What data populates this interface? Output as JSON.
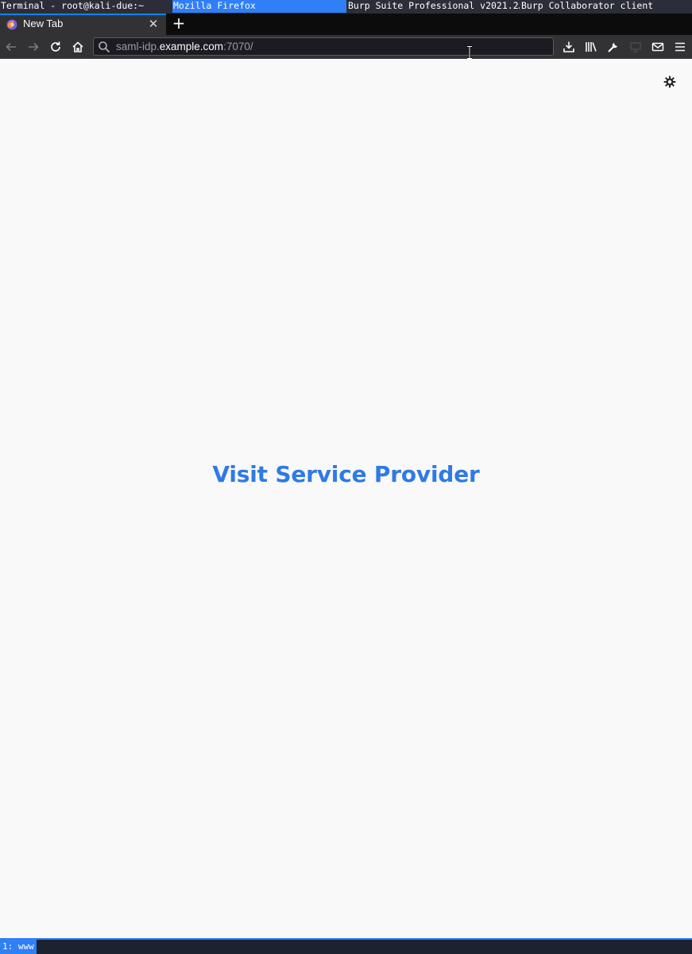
{
  "taskbar": {
    "tasks": [
      {
        "label": "Terminal - root@kali-due:~",
        "active": false
      },
      {
        "label": "Mozilla Firefox",
        "active": true
      },
      {
        "label": "Burp Suite Professional v2021.2…",
        "active": false
      },
      {
        "label": "Burp Collaborator client",
        "active": false
      }
    ]
  },
  "browser": {
    "tab": {
      "title": "New Tab",
      "close_glyph": "✕"
    },
    "new_tab_glyph": "+",
    "url": {
      "prefix": "saml-idp.",
      "host": "example.com",
      "suffix": ":7070/"
    }
  },
  "page": {
    "link_text": "Visit Service Provider",
    "link_color": "#2f7ae5"
  },
  "status_bar": {
    "workspace": "1: www"
  },
  "colors": {
    "accent": "#2f7ff6",
    "toolbar": "#323234",
    "page_bg": "#f9f9fa"
  }
}
